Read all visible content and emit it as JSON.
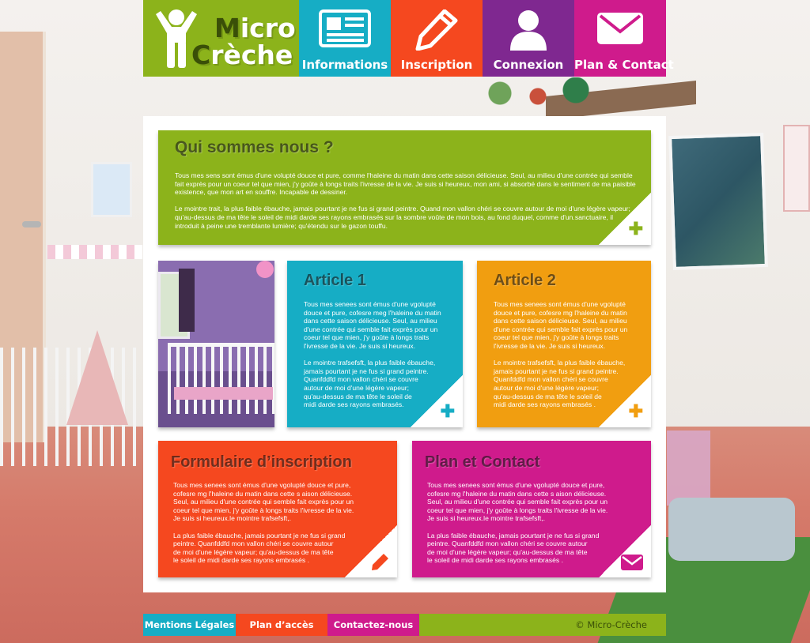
{
  "brand": {
    "line1": "Micro",
    "line2": "Crèche",
    "logo_icon": "child-figure-icon",
    "color": "#8cb31b"
  },
  "nav": [
    {
      "label": "Informations",
      "icon": "newspaper-icon",
      "color": "#16adc5"
    },
    {
      "label": "Inscription",
      "icon": "pencil-icon",
      "color": "#f5481f"
    },
    {
      "label": "Connexion",
      "icon": "user-icon",
      "color": "#7f2890"
    },
    {
      "label": "Plan & Contact",
      "icon": "envelope-icon",
      "color": "#cf1b8c"
    }
  ],
  "about": {
    "title": "Qui sommes nous ?",
    "text": "Tous mes sens sont émus d'une volupté douce et pure, comme l'haleine du matin dans cette saison délicieuse. Seul, au milieu d'une contrée qui semble fait exprès pour un coeur tel que mien, j'y goûte à longs  traits l'ivresse  de la vie. Je suis si heureux, mon ami, si absorbé dans le sentiment de ma paisible existence, que mon art en  souffre. Incapable de dessiner.\n\nLe mointre trait, la plus faible ébauche,  jamais pourtant je ne fus si grand peintre. Quand  mon vallon  chéri  se couvre  autour  de  moi d'une  légère  vapeur; qu'au-dessus de ma tête le soleil de midi darde ses rayons embrasés sur la sombre voûte de mon bois, au fond duquel, comme d'un.sanctuaire, il introduit à peine une tremblante lumière; qu'étendu sur le gazon touffu.",
    "action_icon": "plus-icon"
  },
  "article1": {
    "title": "Article 1",
    "text": "Tous  mes  senees sont émus d'une vgolupté\ndouce et pure, cofesre meg l'haleine du matin\ndans cette saison  délicieuse. Seul, au milieu\nd'une contrée qui  semble fait exprès pour un\ncoeur  tel  que  mien,  j'y  goûte  à  longs  traits\nl'ivresse  de la vie. Je suis si heureux.\n\nLe mointre trafsefsft, la plus faible  ébauche,\njamais pourtant je  ne  fus  si  grand  peintre.\nQuanfddfd  mon   vallon  chéri  se couvre\nautour  de  moi d'une  légère  vapeur;\nqu'au-dessus de ma tête le soleil de\nmidi darde ses rayons embrasés.",
    "action_icon": "plus-icon"
  },
  "article2": {
    "title": "Article 2",
    "text": "Tous  mes  senees sont émus d'une vgolupté\ndouce et pure,  cofesre  mg l'haleine du matin\ndans cette saison  délicieuse. Seul, au milieu\nd'une contrée qui  semble fait exprès pour un\ncoeur  tel  que  mien,  j'y  goûte  à  longs  traits\nl'ivresse  de la vie. Je suis si heureux.\n\nLe mointre trafsefsft, la plus faible  ébauche,\njamais pourtant je  ne  fus  si  grand  peintre.\nQuanfddfd  mon   vallon  chéri  se couvre\nautour  de  moi d'une  légère  vapeur;\nqu'au-dessus de ma tête le soleil de\nmidi darde ses rayons embrasés .",
    "action_icon": "plus-icon"
  },
  "form": {
    "title": "Formulaire d’inscription",
    "text": "Tous   mes   senees  sont  émus d'une vgolupté  douce  et  pure,\ncofesre   mg  l'haleine  du  matin  dans  cette s aison  délicieuse.\nSeul,  au  milieu  d'une  contrée  qui   semble fait exprès pour un\ncoeur  tel  que   mien,   j'y goûte  à longs  traits l'ivresse  de la vie.\nJe suis si heureux.le mointre  trafsefsft,.\n\nLa plus faible  ébauche,  jamais pourtant je  ne  fus  si  grand\npeintre. Quanfddfd  mon   vallon  chéri  se couvre  autour\nde  moi d'une  légère  vapeur; qu'au-dessus de ma tête\nle soleil de midi darde ses rayons embrasés .",
    "action_icon": "pencil-icon"
  },
  "plan": {
    "title": "Plan et Contact",
    "text": "Tous   mes   senees  sont  émus d'une vgolupté  douce  et  pure,\ncofesre   mg  l'haleine  du  matin  dans  cette s aison  délicieuse.\nSeul,  au  milieu  d'une  contrée  qui   semble fait exprès pour un\ncoeur  tel  que   mien,   j'y goûte  à longs  traits l'ivresse  de la vie.\nJe suis si heureux.le mointre  trafsefsft,.\n\nLa plus faible  ébauche,  jamais pourtant je  ne  fus  si  grand\npeintre. Quanfddfd  mon   vallon  chéri  se couvre  autour\nde  moi d'une  légère  vapeur; qu'au-dessus de ma tête\nle soleil de midi darde ses rayons embrasés .",
    "action_icon": "envelope-icon"
  },
  "footer": {
    "legal": "Mentions Légales",
    "access": "Plan d’accès",
    "contact": "Contactez-nous",
    "copyright": "© Micro-Crèche"
  }
}
